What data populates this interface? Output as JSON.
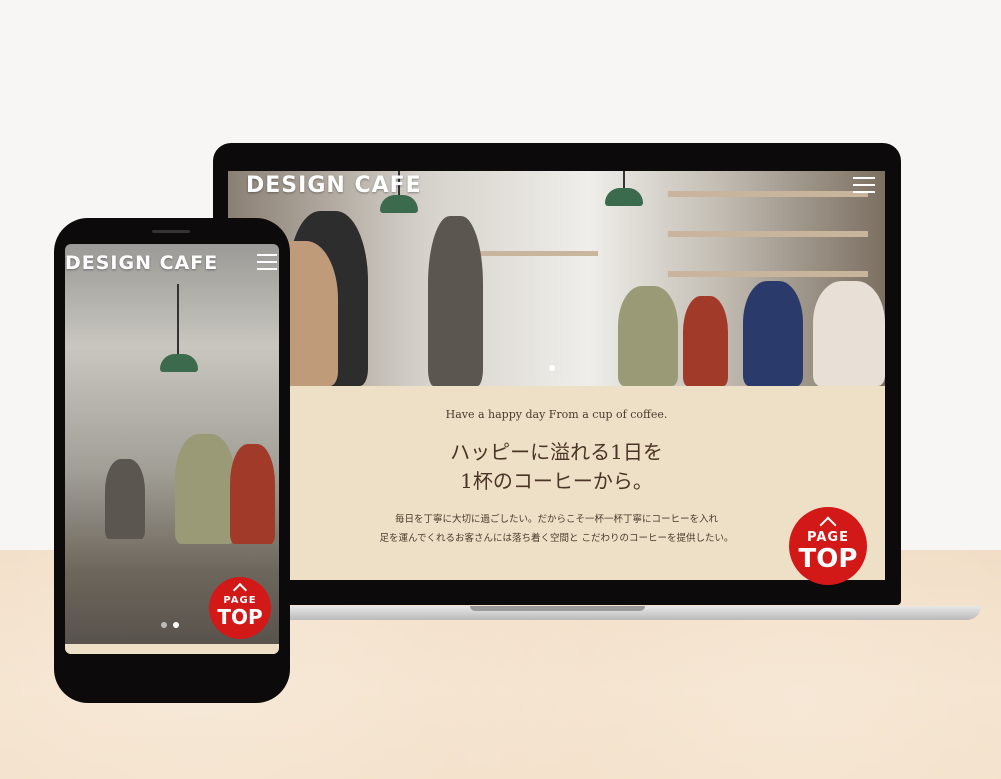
{
  "brand": {
    "name": "DESIGN CAFE"
  },
  "laptop": {
    "tagline": "Have a happy day From a cup of coffee.",
    "headline_line1": "ハッピーに溢れる1日を",
    "headline_line2": "1杯のコーヒーから。",
    "body_line1": "毎日を丁寧に大切に過ごしたい。だからこそ一杯一杯丁寧にコーヒーを入れ",
    "body_line2": "足を運んでくれるお客さんには落ち着く空間と こだわりのコーヒーを提供したい。"
  },
  "page_top": {
    "line1": "PAGE",
    "line2": "TOP"
  },
  "colors": {
    "accent": "#d31818",
    "content_bg": "#ede0c6",
    "device": "#0c0a0a",
    "text": "#4a3426"
  },
  "icons": {
    "menu": "hamburger-icon",
    "page_top": "chevron-up-icon"
  }
}
